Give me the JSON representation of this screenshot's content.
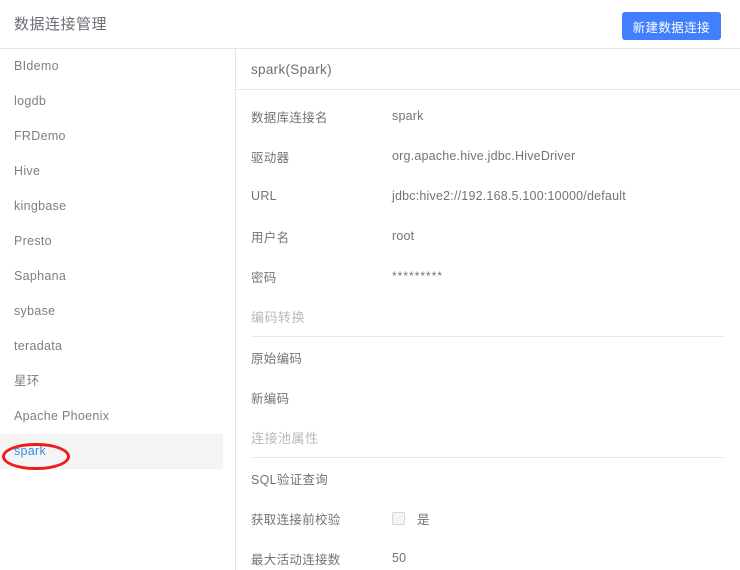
{
  "header": {
    "page_title": "数据连接管理",
    "new_connection_button": "新建数据连接",
    "accent_color": "#4080ff"
  },
  "sidebar": {
    "items": [
      {
        "label": "BIdemo",
        "active": false
      },
      {
        "label": "logdb",
        "active": false
      },
      {
        "label": "FRDemo",
        "active": false
      },
      {
        "label": "Hive",
        "active": false
      },
      {
        "label": "kingbase",
        "active": false
      },
      {
        "label": "Presto",
        "active": false
      },
      {
        "label": "Saphana",
        "active": false
      },
      {
        "label": "sybase",
        "active": false
      },
      {
        "label": "teradata",
        "active": false
      },
      {
        "label": "星环",
        "active": false
      },
      {
        "label": "Apache Phoenix",
        "active": false
      },
      {
        "label": "spark",
        "active": true
      }
    ],
    "active_item_label": "spark",
    "active_text_color": "#3a8ee6",
    "active_row_background": "#f4f4f5"
  },
  "annotation": {
    "shape": "ellipse-outline",
    "color": "#ee1b1b",
    "targets": "spark"
  },
  "detail": {
    "title": "spark(Spark)",
    "rows": [
      {
        "type": "field",
        "label": "数据库连接名",
        "value": "spark"
      },
      {
        "type": "field",
        "label": "驱动器",
        "value": "org.apache.hive.jdbc.HiveDriver"
      },
      {
        "type": "field",
        "label": "URL",
        "value": "jdbc:hive2://192.168.5.100:10000/default"
      },
      {
        "type": "field",
        "label": "用户名",
        "value": "root"
      },
      {
        "type": "field",
        "label": "密码",
        "value": "*********",
        "masked": true
      },
      {
        "type": "section",
        "label": "编码转换"
      },
      {
        "type": "field",
        "label": "原始编码",
        "value": ""
      },
      {
        "type": "field",
        "label": "新编码",
        "value": ""
      },
      {
        "type": "section",
        "label": "连接池属性"
      },
      {
        "type": "field",
        "label": "SQL验证查询",
        "value": ""
      },
      {
        "type": "checkbox",
        "label": "获取连接前校验",
        "checkbox_label": "是",
        "checked": false
      },
      {
        "type": "field",
        "label": "最大活动连接数",
        "value": "50"
      }
    ]
  }
}
